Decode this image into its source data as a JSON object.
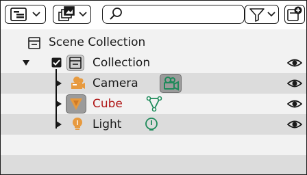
{
  "scene": {
    "label": "Scene Collection"
  },
  "collection": {
    "label": "Collection"
  },
  "objects": [
    {
      "label": "Camera",
      "color": "#1a1a1a"
    },
    {
      "label": "Cube",
      "color": "#b01818"
    },
    {
      "label": "Light",
      "color": "#1a1a1a"
    }
  ],
  "colors": {
    "row_alt": "#dcdcdc",
    "row_base": "#f2f2f2",
    "data_green": "#1e8a5a",
    "object_orange": "#e79a3f",
    "text": "#1a1a1a"
  },
  "icons": {
    "display_mode": "outliner-display-icon",
    "view_layer": "view-layer-icon",
    "search": "search-icon",
    "filter": "filter-icon",
    "new_collection": "new-collection-icon",
    "visibility": "eye-icon"
  }
}
